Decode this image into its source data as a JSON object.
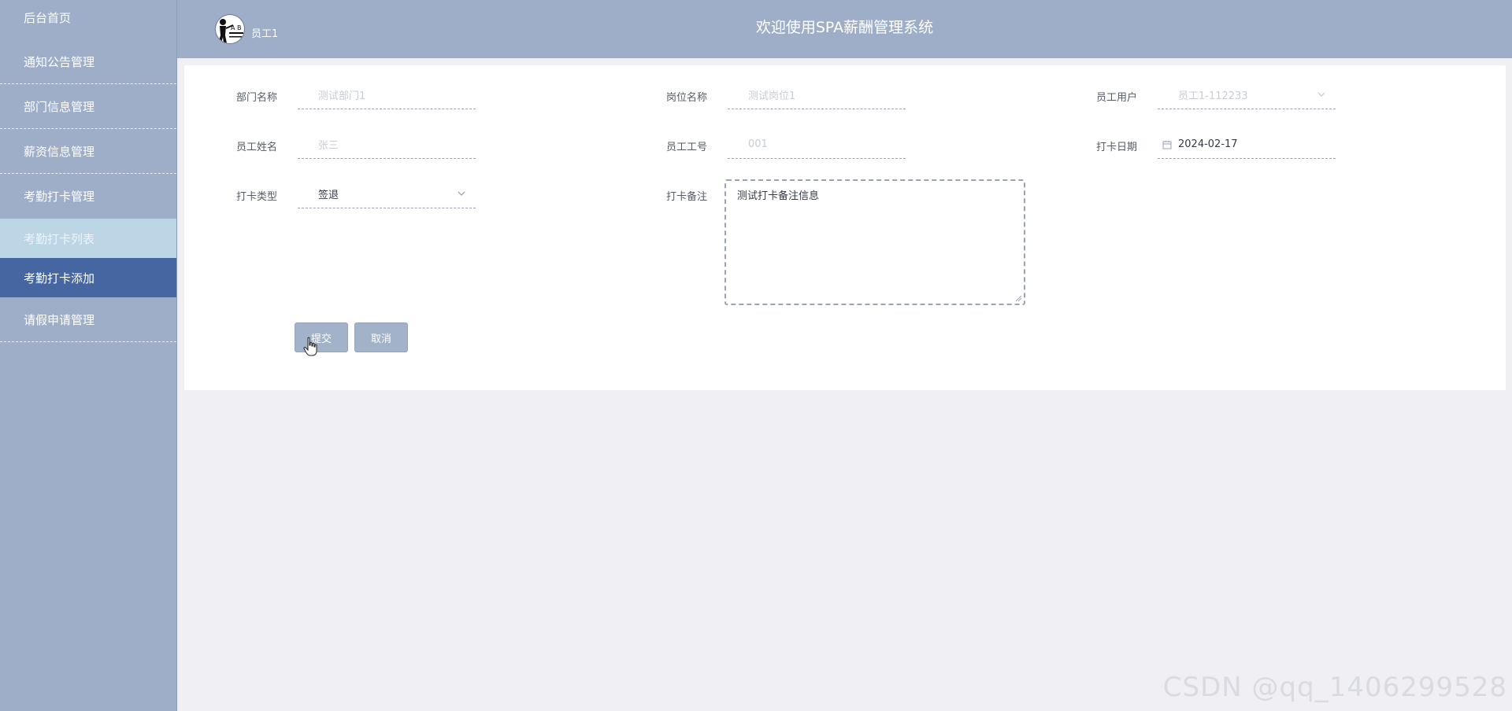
{
  "app": {
    "system_title": "欢迎使用SPA薪酬管理系统",
    "username": "员工1"
  },
  "sidebar": {
    "items": [
      {
        "label": "后台首页"
      },
      {
        "label": "通知公告管理"
      },
      {
        "label": "部门信息管理"
      },
      {
        "label": "薪资信息管理"
      },
      {
        "label": "考勤打卡管理"
      },
      {
        "label": "考勤打卡列表"
      },
      {
        "label": "考勤打卡添加"
      },
      {
        "label": "请假申请管理"
      }
    ]
  },
  "form": {
    "department_label": "部门名称",
    "department_value": "测试部门1",
    "position_label": "岗位名称",
    "position_value": "测试岗位1",
    "user_label": "员工用户",
    "user_value": "员工1-112233",
    "name_label": "员工姓名",
    "name_value": "张三",
    "employee_no_label": "员工工号",
    "employee_no_value": "001",
    "date_label": "打卡日期",
    "date_value": "2024-02-17",
    "type_label": "打卡类型",
    "type_value": "签退",
    "remark_label": "打卡备注",
    "remark_value": "测试打卡备注信息",
    "submit_label": "提交",
    "cancel_label": "取消"
  },
  "watermark": "CSDN @qq_1406299528"
}
